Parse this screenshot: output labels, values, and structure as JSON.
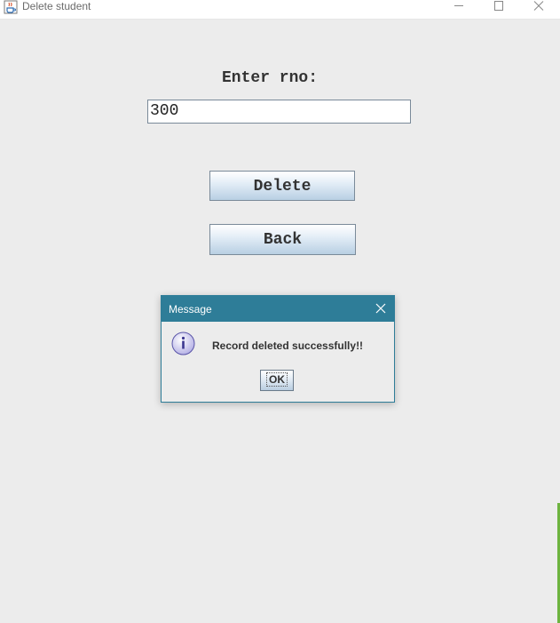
{
  "window": {
    "title": "Delete student",
    "icon": "java-cup-icon",
    "controls": [
      "minimize",
      "maximize",
      "close"
    ]
  },
  "form": {
    "label": "Enter rno:",
    "rno_value": "300",
    "delete_label": "Delete",
    "back_label": "Back"
  },
  "dialog": {
    "title": "Message",
    "icon": "info-icon",
    "message": "Record deleted successfully!!",
    "ok_label": "OK"
  },
  "colors": {
    "dialog_title_bg": "#2e7d98",
    "content_bg": "#ececec",
    "button_gradient_bottom": "#b8cfe3"
  }
}
